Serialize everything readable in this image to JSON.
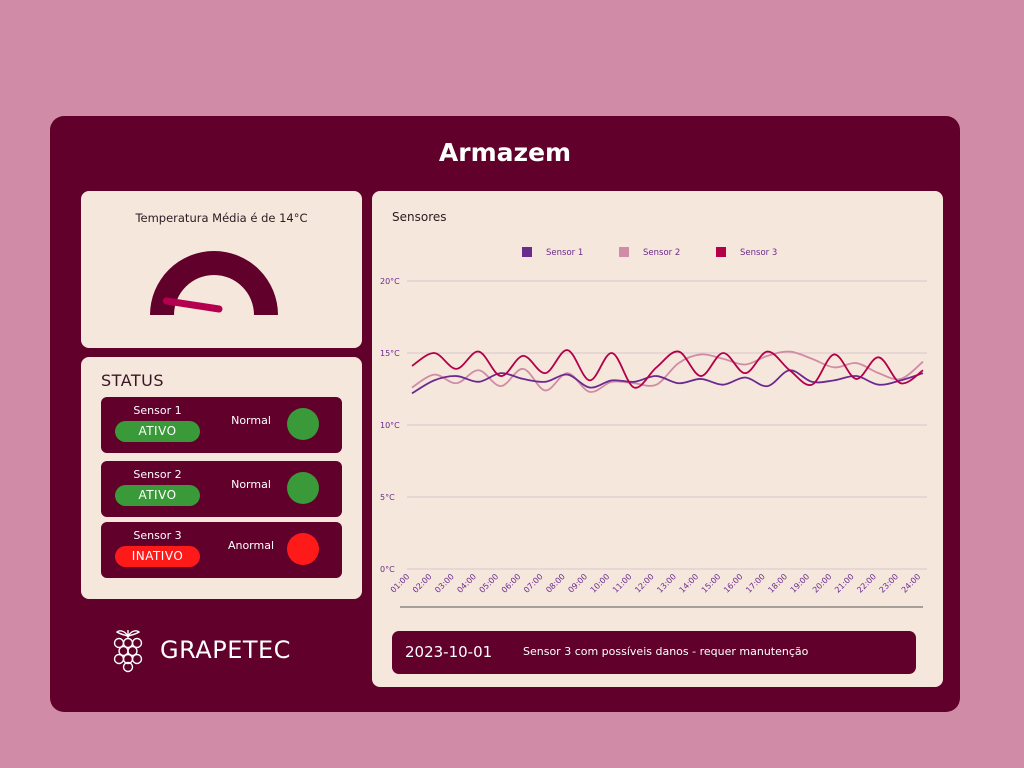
{
  "page": {
    "title": "Armazem"
  },
  "gauge": {
    "label": "Temperatura Média é de 14°C",
    "value_fraction": 0.15,
    "colors": {
      "track": "#60002b",
      "needle": "#b5004f"
    }
  },
  "status": {
    "title": "STATUS",
    "sensors": [
      {
        "name": "Sensor 1",
        "state": "ATIVO",
        "condition": "Normal",
        "state_color": "#3a9a3a",
        "dot_color": "#3a9a3a"
      },
      {
        "name": "Sensor 2",
        "state": "ATIVO",
        "condition": "Normal",
        "state_color": "#3a9a3a",
        "dot_color": "#3a9a3a"
      },
      {
        "name": "Sensor 3",
        "state": "INATIVO",
        "condition": "Anormal",
        "state_color": "#ff1a1a",
        "dot_color": "#ff1a1a"
      }
    ]
  },
  "brand": {
    "name": "GRAPETEC",
    "icon": "grape-icon"
  },
  "chart": {
    "title": "Sensores"
  },
  "alert": {
    "date": "2023-10-01",
    "message": "Sensor 3 com possíveis danos - requer manutenção"
  },
  "chart_data": {
    "type": "line",
    "title": "Sensores",
    "x": [
      "01:00",
      "02:00",
      "03:00",
      "04:00",
      "05:00",
      "06:00",
      "07:00",
      "08:00",
      "09:00",
      "10:00",
      "11:00",
      "12:00",
      "13:00",
      "14:00",
      "15:00",
      "16:00",
      "17:00",
      "18:00",
      "19:00",
      "20:00",
      "21:00",
      "22:00",
      "23:00",
      "24:00"
    ],
    "y_ticks": [
      "0°C",
      "5°C",
      "10°C",
      "15°C",
      "20°C"
    ],
    "ylim": [
      0,
      20
    ],
    "grid": true,
    "legend_position": "top-center",
    "series": [
      {
        "name": "Sensor 1",
        "color": "#6a2a8e",
        "values": [
          12.2,
          13.1,
          13.4,
          13.0,
          13.6,
          13.2,
          13.0,
          13.5,
          12.6,
          13.1,
          13.0,
          13.4,
          12.9,
          13.2,
          12.8,
          13.3,
          12.7,
          13.8,
          13.0,
          13.1,
          13.4,
          12.8,
          13.1,
          13.6
        ]
      },
      {
        "name": "Sensor 2",
        "color": "#d08ca6",
        "values": [
          12.6,
          13.5,
          12.9,
          13.8,
          12.7,
          13.9,
          12.4,
          13.6,
          12.3,
          13.0,
          12.9,
          12.8,
          14.3,
          14.9,
          14.6,
          14.2,
          14.8,
          15.1,
          14.6,
          14.0,
          14.3,
          13.6,
          13.2,
          14.4
        ]
      },
      {
        "name": "Sensor 3",
        "color": "#b30049",
        "values": [
          14.1,
          15.0,
          13.9,
          15.1,
          13.4,
          14.8,
          13.6,
          15.2,
          13.1,
          15.0,
          12.6,
          14.0,
          15.1,
          13.4,
          15.0,
          13.6,
          15.1,
          13.8,
          12.8,
          14.9,
          13.2,
          14.7,
          12.9,
          13.8
        ]
      }
    ]
  }
}
